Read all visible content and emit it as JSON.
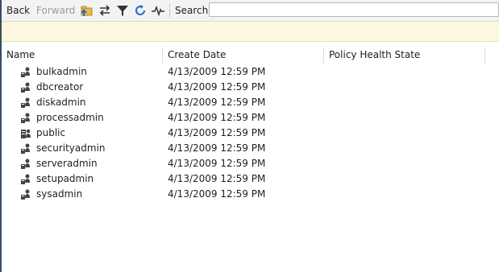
{
  "toolbar": {
    "back_label": "Back",
    "forward_label": "Forward",
    "search_label": "Search",
    "search_value": "",
    "icons": [
      "new-folder-icon",
      "sync-icon",
      "filter-icon",
      "refresh-icon",
      "activity-icon"
    ]
  },
  "columns": {
    "name": "Name",
    "create_date": "Create Date",
    "policy_health_state": "Policy Health State"
  },
  "rows": [
    {
      "name": "bulkadmin",
      "create_date": "4/13/2009 12:59 PM",
      "icon": "server-role-icon"
    },
    {
      "name": "dbcreator",
      "create_date": "4/13/2009 12:59 PM",
      "icon": "server-role-icon"
    },
    {
      "name": "diskadmin",
      "create_date": "4/13/2009 12:59 PM",
      "icon": "server-role-icon"
    },
    {
      "name": "processadmin",
      "create_date": "4/13/2009 12:59 PM",
      "icon": "server-role-icon"
    },
    {
      "name": "public",
      "create_date": "4/13/2009 12:59 PM",
      "icon": "public-role-icon"
    },
    {
      "name": "securityadmin",
      "create_date": "4/13/2009 12:59 PM",
      "icon": "server-role-icon"
    },
    {
      "name": "serveradmin",
      "create_date": "4/13/2009 12:59 PM",
      "icon": "server-role-icon"
    },
    {
      "name": "setupadmin",
      "create_date": "4/13/2009 12:59 PM",
      "icon": "server-role-icon"
    },
    {
      "name": "sysadmin",
      "create_date": "4/13/2009 12:59 PM",
      "icon": "server-role-icon"
    }
  ],
  "colors": {
    "info_bar_bg": "#fcf8dd",
    "toolbar_bg": "#f3f3f3",
    "left_border": "#3a4a63"
  }
}
